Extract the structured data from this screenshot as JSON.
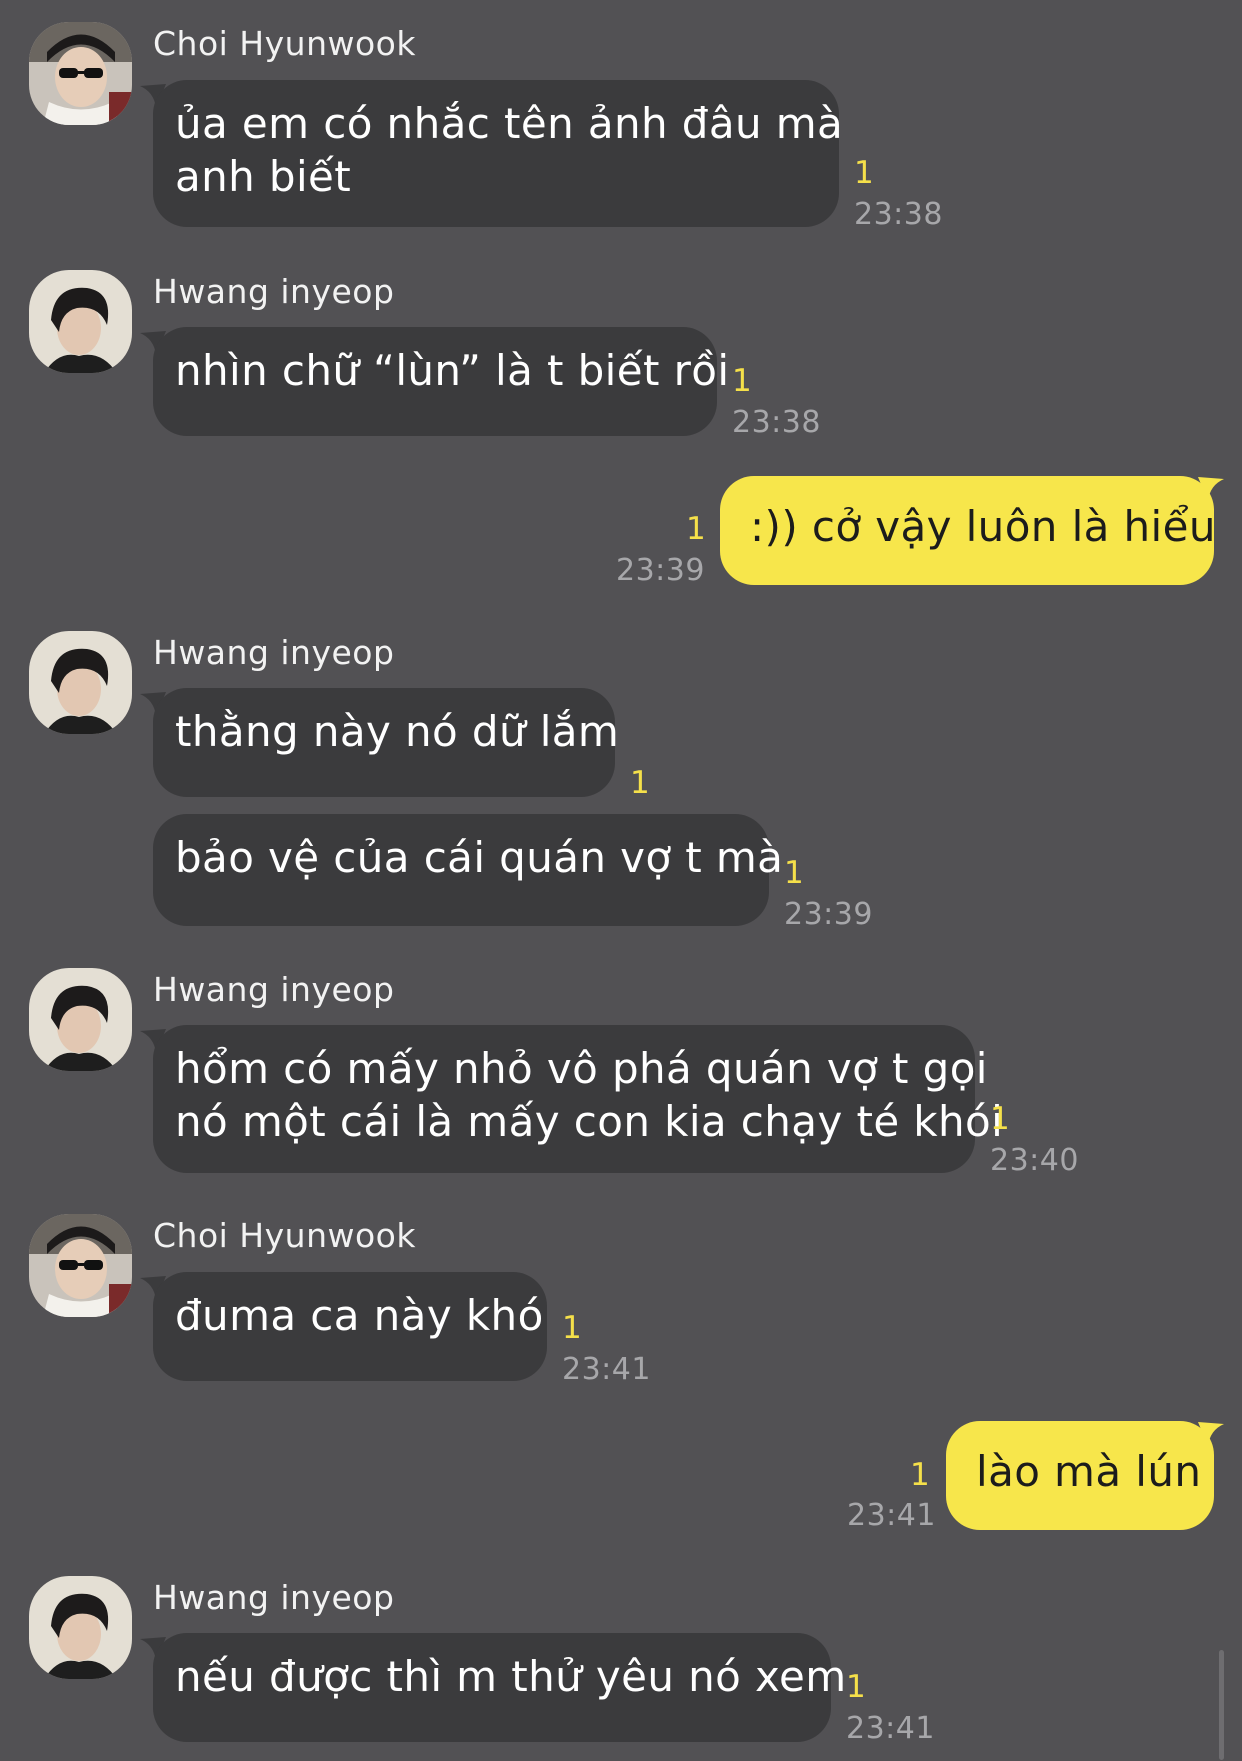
{
  "colors": {
    "background": "#525154",
    "incoming_bubble": "#3b3b3d",
    "outgoing_bubble": "#f7e64b",
    "read_count": "#f5e04a",
    "timestamp": "#a7a7aa"
  },
  "senders": {
    "choi": "Choi Hyunwook",
    "hwang": "Hwang inyeop"
  },
  "messages": [
    {
      "sender": "Choi Hyunwook",
      "lines": [
        "ủa em có nhắc tên ảnh đâu mà",
        "anh biết"
      ],
      "read": "1",
      "time": "23:38"
    },
    {
      "sender": "Hwang inyeop",
      "lines": [
        "nhìn chữ “lùn” là t biết rồi"
      ],
      "read": "1",
      "time": "23:38"
    },
    {
      "sender": "me",
      "lines": [
        ":)) cở vậy luôn là hiểu"
      ],
      "read": "1",
      "time": "23:39"
    },
    {
      "sender": "Hwang inyeop",
      "lines": [
        "thằng này nó dữ lắm"
      ],
      "read": "1",
      "time": ""
    },
    {
      "sender": "Hwang inyeop",
      "lines": [
        "bảo vệ của cái quán vợ t mà"
      ],
      "read": "1",
      "time": "23:39"
    },
    {
      "sender": "Hwang inyeop",
      "lines": [
        "hổm có mấy nhỏ vô phá quán vợ t gọi",
        "nó một cái là mấy con kia chạy té khói"
      ],
      "read": "1",
      "time": "23:40"
    },
    {
      "sender": "Choi Hyunwook",
      "lines": [
        "đuma ca này khó"
      ],
      "read": "1",
      "time": "23:41"
    },
    {
      "sender": "me",
      "lines": [
        "lào mà lún"
      ],
      "read": "1",
      "time": "23:41"
    },
    {
      "sender": "Hwang inyeop",
      "lines": [
        "nếu được thì m thử yêu nó xem"
      ],
      "read": "1",
      "time": "23:41"
    }
  ]
}
